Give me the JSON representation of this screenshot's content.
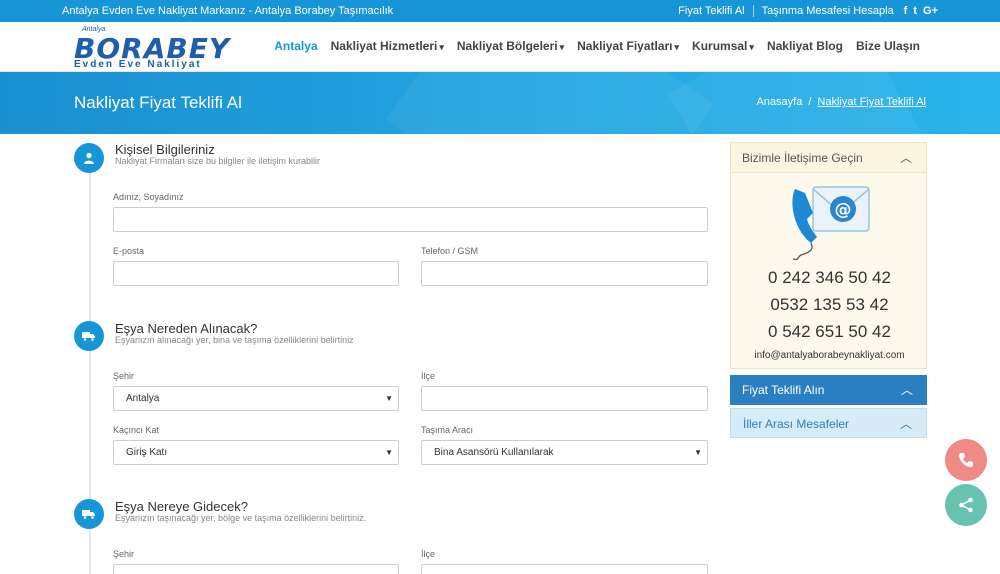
{
  "topbar": {
    "tagline": "Antalya Evden Eve Nakliyat Markanız - Antalya Borabey Taşımacılık",
    "link_quote": "Fiyat Teklifi Al",
    "link_distance": "Taşınma Mesafesi Hesapla",
    "social": [
      "f",
      "t",
      "G+"
    ]
  },
  "logo": {
    "city": "Antalya",
    "brand": "BORABEY",
    "tagline": "Evden Eve Nakliyat"
  },
  "nav": [
    {
      "label": "Antalya",
      "dropdown": false
    },
    {
      "label": "Nakliyat Hizmetleri",
      "dropdown": true
    },
    {
      "label": "Nakliyat Bölgeleri",
      "dropdown": true
    },
    {
      "label": "Nakliyat Fiyatları",
      "dropdown": true
    },
    {
      "label": "Kurumsal",
      "dropdown": true
    },
    {
      "label": "Nakliyat Blog",
      "dropdown": false
    },
    {
      "label": "Bize Ulaşın",
      "dropdown": false
    }
  ],
  "banner": {
    "title": "Nakliyat Fiyat Teklifi Al",
    "crumb_home": "Anasayfa",
    "crumb_sep": "/",
    "crumb_current": "Nakliyat Fiyat Teklifi Al"
  },
  "sections": {
    "personal": {
      "title": "Kişisel Bilgileriniz",
      "subtitle": "Nakliyat Firmaları size bu bilgiler ile iletişim kurabilir",
      "name_label": "Adınız, Soyadınız",
      "email_label": "E-posta",
      "phone_label": "Telefon / GSM"
    },
    "origin": {
      "title": "Eşya Nereden Alınacak?",
      "subtitle": "Eşyanızın alınacağı yer, bina ve taşıma özelliklerini belirtiniz",
      "city_label": "Şehir",
      "city_value": "Antalya",
      "district_label": "İlçe",
      "floor_label": "Kaçıncı Kat",
      "floor_value": "Giriş Katı",
      "transport_label": "Taşıma Aracı",
      "transport_value": "Bina Asansörü Kullanılarak"
    },
    "destination": {
      "title": "Eşya Nereye Gidecek?",
      "subtitle": "Eşyanızın taşınacağı yer, bölge ve taşıma özelliklerini belirtiniz.",
      "city_label": "Şehir",
      "district_label": "İlçe"
    }
  },
  "sidebar": {
    "contact_title": "Bizimle İletişime Geçin",
    "phones": [
      "0 242 346 50 42",
      "0532 135 53 42",
      "0 542 651 50 42"
    ],
    "email": "info@antalyaborabeynakliyat.com",
    "quote_title": "Fiyat Teklifi Alın",
    "distance_title": "İller Arası Mesafeler"
  },
  "colors": {
    "primary": "#1696d6",
    "accordion_blue": "#2a7fc1",
    "call_fab": "#ef8a85",
    "share_fab": "#67c2b0"
  },
  "icons": [
    "user-icon",
    "truck-icon",
    "email-phone-icon",
    "phone-icon",
    "share-icon",
    "chevron-up-icon",
    "caret-down-icon"
  ]
}
